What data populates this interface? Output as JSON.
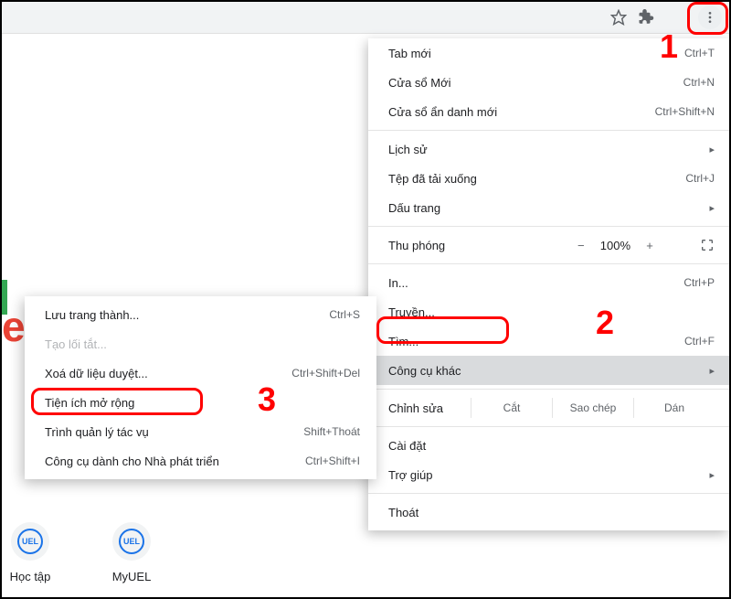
{
  "toolbar": {
    "star": "star-icon",
    "ext": "extensions-icon",
    "more": "more-icon"
  },
  "menu": {
    "new_tab": {
      "label": "Tab mới",
      "shortcut": "Ctrl+T"
    },
    "new_window": {
      "label": "Cửa sổ Mới",
      "shortcut": "Ctrl+N"
    },
    "incognito": {
      "label": "Cửa sổ ẩn danh mới",
      "shortcut": "Ctrl+Shift+N"
    },
    "history": {
      "label": "Lịch sử"
    },
    "downloads": {
      "label": "Tệp đã tải xuống",
      "shortcut": "Ctrl+J"
    },
    "bookmarks": {
      "label": "Dấu trang"
    },
    "zoom": {
      "label": "Thu phóng",
      "value": "100%",
      "minus": "−",
      "plus": "+",
      "full": "⛶"
    },
    "print": {
      "label": "In...",
      "shortcut": "Ctrl+P"
    },
    "cast": {
      "label": "Truyền..."
    },
    "find": {
      "label": "Tìm...",
      "shortcut": "Ctrl+F"
    },
    "more_tools": {
      "label": "Công cụ khác"
    },
    "edit": {
      "label": "Chỉnh sửa",
      "cut": "Cắt",
      "copy": "Sao chép",
      "paste": "Dán"
    },
    "settings": {
      "label": "Cài đặt"
    },
    "help": {
      "label": "Trợ giúp"
    },
    "exit": {
      "label": "Thoát"
    }
  },
  "submenu": {
    "save_as": {
      "label": "Lưu trang thành...",
      "shortcut": "Ctrl+S"
    },
    "create_shortcut": {
      "label": "Tạo lối tắt..."
    },
    "clear_data": {
      "label": "Xoá dữ liệu duyệt...",
      "shortcut": "Ctrl+Shift+Del"
    },
    "extensions": {
      "label": "Tiện ích mở rộng"
    },
    "task_manager": {
      "label": "Trình quản lý tác vụ",
      "shortcut": "Shift+Thoát"
    },
    "dev_tools": {
      "label": "Công cụ dành cho Nhà phát triển",
      "shortcut": "Ctrl+Shift+I"
    }
  },
  "callouts": {
    "c1": "1",
    "c2": "2",
    "c3": "3"
  },
  "page": {
    "shortcut1": "Học tập",
    "shortcut2": "MyUEL",
    "uel": "UEL"
  }
}
